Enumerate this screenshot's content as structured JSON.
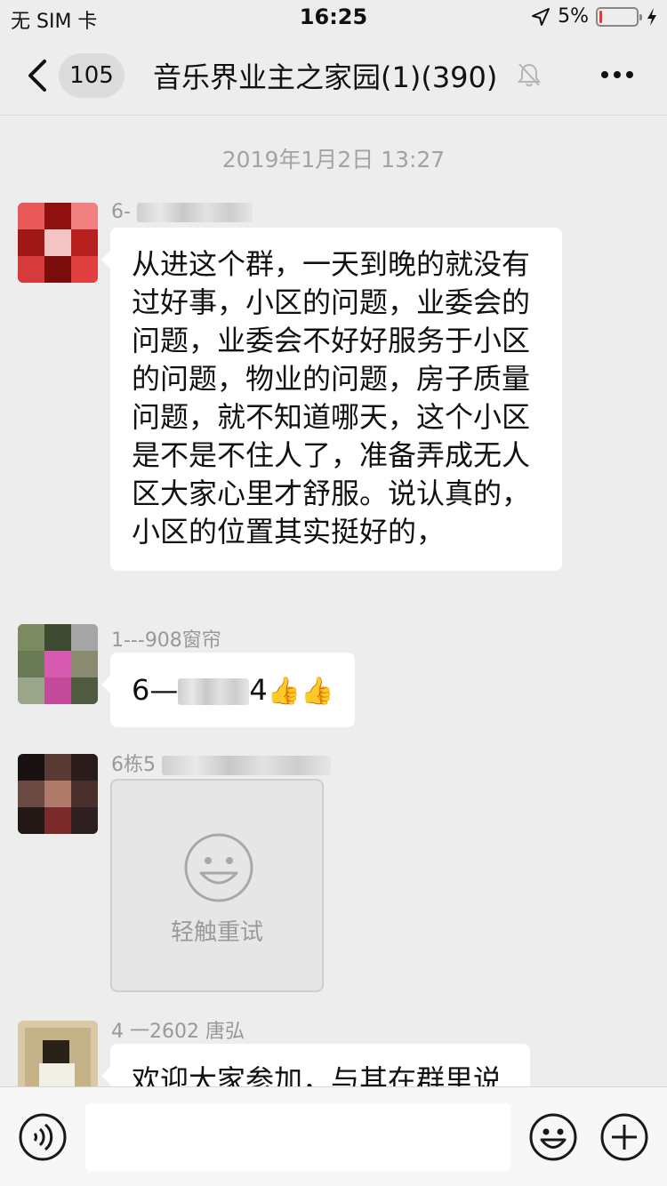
{
  "status_bar": {
    "carrier": "无 SIM 卡",
    "time": "16:25",
    "battery_percent": "5%",
    "battery_level": 0.05,
    "icons": [
      "location-arrow-icon",
      "battery-icon",
      "charging-bolt-icon"
    ]
  },
  "nav": {
    "back_icon": "chevron-left-icon",
    "unread_count": "105",
    "title": "音乐界业主之家园(1)(390)",
    "mute_icon": "bell-muted-icon",
    "more_icon": "more-dots-icon"
  },
  "chat": {
    "timestamp": "2019年1月2日 13:27",
    "messages": [
      {
        "sender_visible": "6-",
        "text": "从进这个群，一天到晚的就没有过好事，小区的问题，业委会的问题，业委会不好好服务于小区的问题，物业的问题，房子质量问题，就不知道哪天，这个小区是不是不住人了，准备弄成无人区大家心里才舒服。说认真的，小区的位置其实挺好的，",
        "avatar_color": "#c81e1e"
      },
      {
        "sender": "1---908窗帘",
        "text_prefix": "6—",
        "text_suffix": "4",
        "emoji": "👍👍",
        "avatar_color": "#5b6b4a"
      },
      {
        "sender_visible": "6栋5",
        "retry_label": "轻触重试",
        "retry_icon": "smiley-face-icon",
        "avatar_color": "#3a2a28"
      },
      {
        "sender": "4 一2602 唐弘",
        "text": "欢迎大家参加，与其在群里说",
        "avatar_color": "#d9c9a6"
      }
    ]
  },
  "input_bar": {
    "voice_icon": "voice-icon",
    "input_value": "",
    "emoji_icon": "emoji-face-icon",
    "plus_icon": "plus-circle-icon"
  }
}
